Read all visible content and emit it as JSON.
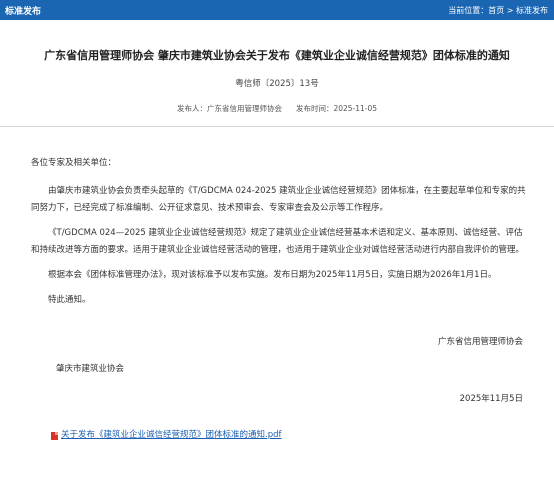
{
  "topbar": {
    "section": "标准发布",
    "breadcrumb_prefix": "当前位置：",
    "home": "首页",
    "separator": ">",
    "current": "标准发布"
  },
  "article": {
    "title": "广东省信用管理师协会 肇庆市建筑业协会关于发布《建筑业企业诚信经营规范》团体标准的通知",
    "doc_no": "粤信师〔2025〕13号",
    "publisher": "发布人：广东省信用管理师协会",
    "publish_time": "发布时间：2025-11-05",
    "salutation": "各位专家及相关单位：",
    "paragraphs": [
      "由肇庆市建筑业协会负责牵头起草的《T/GDCMA 024-2025 建筑业企业诚信经营规范》团体标准，在主要起草单位和专家的共同努力下，已经完成了标准编制、公开征求意见、技术预审会、专家审查会及公示等工作程序。",
      "《T/GDCMA 024—2025 建筑业企业诚信经营规范》规定了建筑业企业诚信经营基本术语和定义、基本原则、诚信经营、评估和持续改进等方面的要求。适用于建筑业企业诚信经营活动的管理，也适用于建筑业企业对诚信经营活动进行内部自我评价的管理。",
      "根据本会《团体标准管理办法》，现对该标准予以发布实施。发布日期为2025年11月5日，实施日期为2026年1月1日。",
      "特此通知。"
    ],
    "signature_org1": "广东省信用管理师协会",
    "signature_org2": "肇庆市建筑业协会",
    "signature_date": "2025年11月5日",
    "attachment": "关于发布《建筑业企业诚信经营规范》团体标准的通知.pdf"
  },
  "colors": {
    "header_bg": "#1a66b3",
    "link": "#1a5fb4",
    "pdf_icon": "#d9342b"
  },
  "icons": {
    "attachment": "pdf-file-icon"
  }
}
